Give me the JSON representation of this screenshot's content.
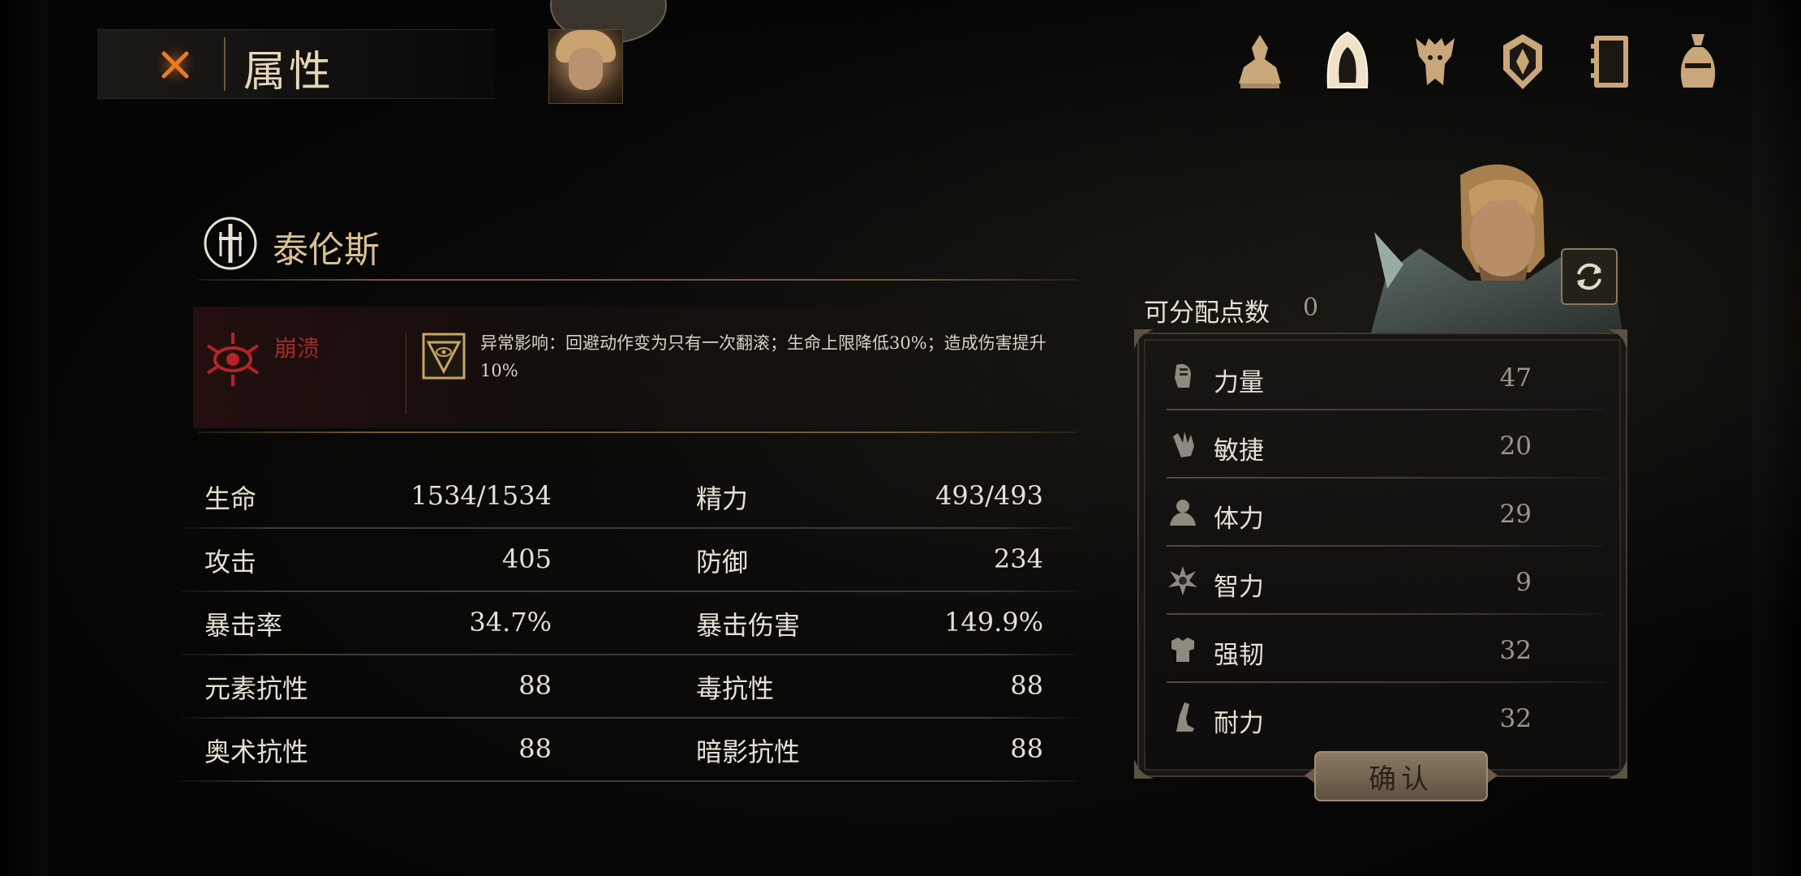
{
  "header": {
    "title": "属性"
  },
  "nav_icons": [
    "character-icon",
    "hood-icon",
    "beast-icon",
    "shield-emblem-icon",
    "journal-icon",
    "pouch-icon"
  ],
  "character": {
    "name": "泰伦斯"
  },
  "status_effect": {
    "name": "崩溃",
    "description": "异常影响：回避动作变为只有一次翻滚；生命上限降低30%；造成伤害提升10%"
  },
  "stats": [
    {
      "left_label": "生命",
      "left_value": "1534/1534",
      "right_label": "精力",
      "right_value": "493/493"
    },
    {
      "left_label": "攻击",
      "left_value": "405",
      "right_label": "防御",
      "right_value": "234"
    },
    {
      "left_label": "暴击率",
      "left_value": "34.7%",
      "right_label": "暴击伤害",
      "right_value": "149.9%"
    },
    {
      "left_label": "元素抗性",
      "left_value": "88",
      "right_label": "毒抗性",
      "right_value": "88"
    },
    {
      "left_label": "奥术抗性",
      "left_value": "88",
      "right_label": "暗影抗性",
      "right_value": "88"
    }
  ],
  "allocation": {
    "points_label": "可分配点数",
    "points_value": "0",
    "attributes": [
      {
        "icon": "fist-icon",
        "label": "力量",
        "value": "47"
      },
      {
        "icon": "hand-icon",
        "label": "敏捷",
        "value": "20"
      },
      {
        "icon": "bust-icon",
        "label": "体力",
        "value": "29"
      },
      {
        "icon": "spark-icon",
        "label": "智力",
        "value": "9"
      },
      {
        "icon": "armor-icon",
        "label": "强韧",
        "value": "32"
      },
      {
        "icon": "leg-icon",
        "label": "耐力",
        "value": "32"
      }
    ],
    "confirm_label": "确认"
  },
  "colors": {
    "accent_gold": "#d9bf93",
    "status_red": "#a52a2a",
    "close_orange": "#e2681f"
  }
}
